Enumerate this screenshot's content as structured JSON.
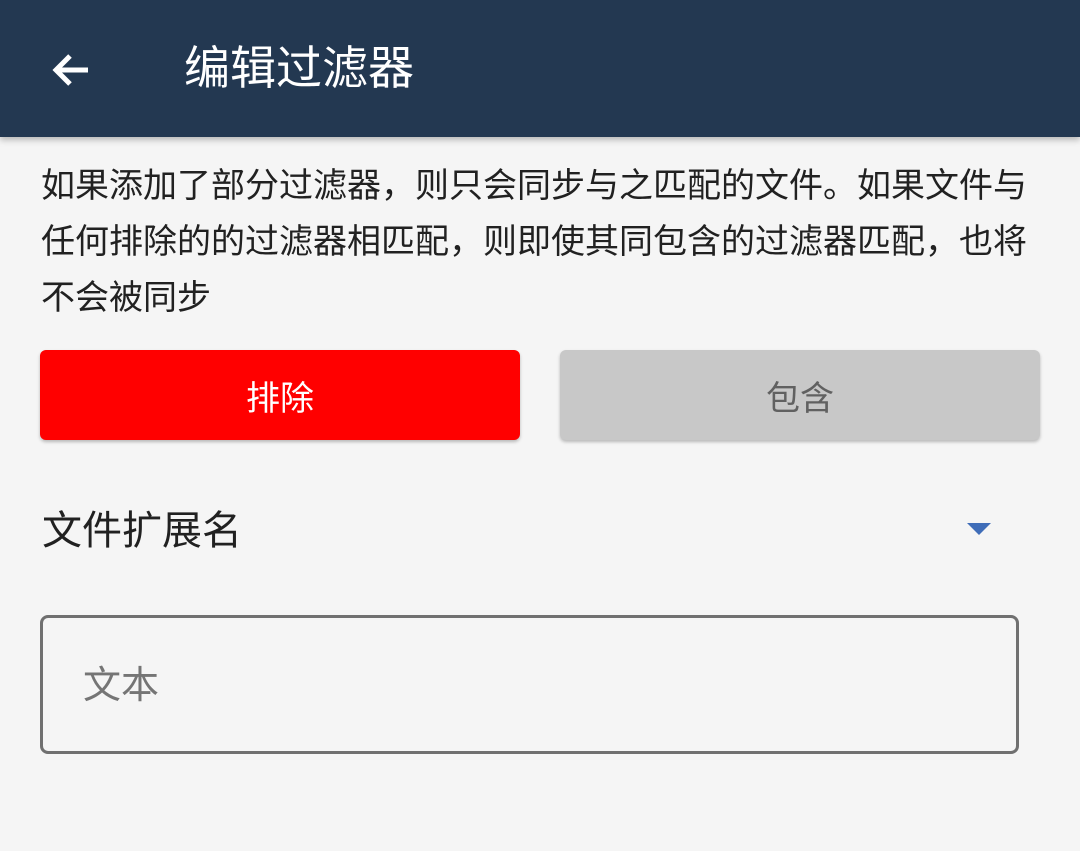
{
  "app_bar": {
    "back_icon": "arrow-left-icon",
    "title": "编辑过滤器",
    "background": "#233851"
  },
  "description": "如果添加了部分过滤器，则只会同步与之匹配的文件。如果文件与任何排除的的过滤器相匹配，则即使其同包含的过滤器匹配，也将不会被同步",
  "filter_mode": {
    "exclude_label": "排除",
    "include_label": "包含",
    "selected": "exclude",
    "exclude_color": "#ff0000",
    "include_color": "#c8c8c8"
  },
  "filter_type": {
    "selected": "文件扩展名",
    "dropdown_icon": "triangle-down-icon",
    "arrow_color": "#3f6db8"
  },
  "text_field": {
    "value": "",
    "placeholder": "文本"
  }
}
